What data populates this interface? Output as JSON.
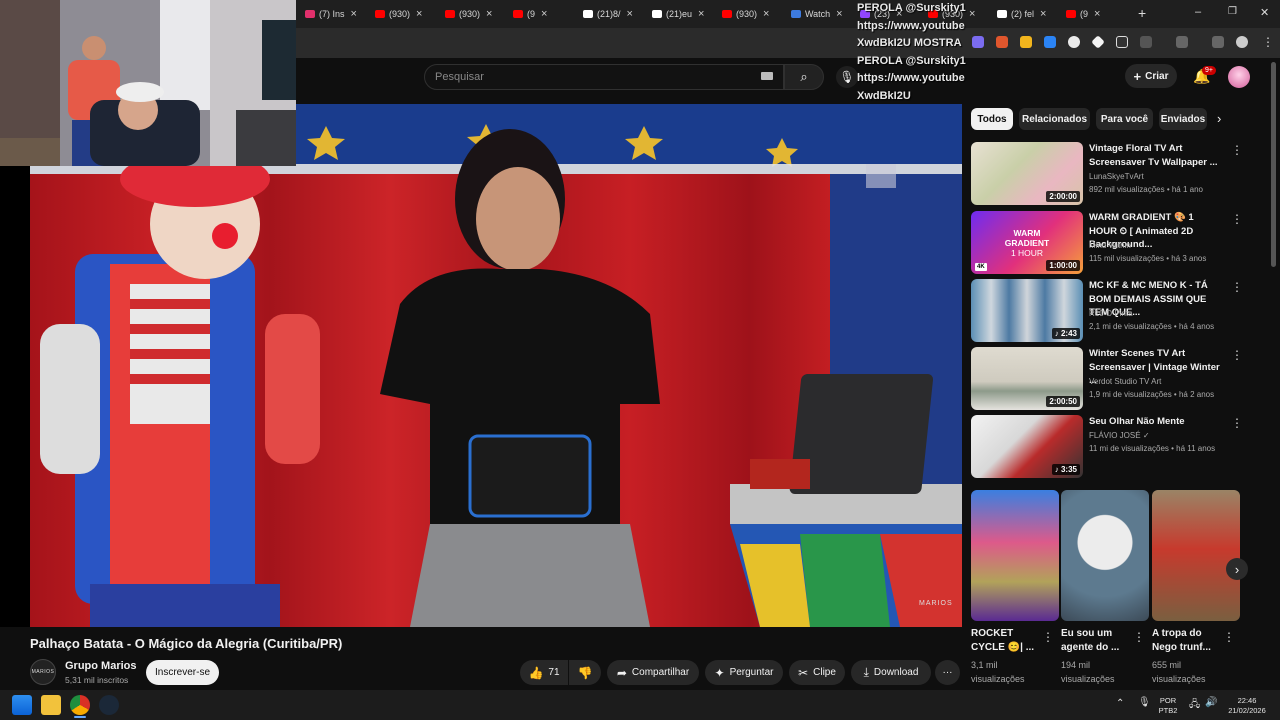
{
  "browser": {
    "tabs": [
      {
        "label": "(7) Ins",
        "icon": "instagram-icon",
        "color": "#e1306c"
      },
      {
        "label": "(930)",
        "icon": "youtube-icon",
        "color": "#ff0000"
      },
      {
        "label": "(930)",
        "icon": "youtube-icon",
        "color": "#ff0000"
      },
      {
        "label": "(9",
        "icon": "youtube-icon",
        "color": "#ff0000"
      },
      {
        "label": "(21)8/",
        "icon": "tiktok-icon",
        "color": "#ffffff"
      },
      {
        "label": "(21)eu",
        "icon": "tiktok-icon",
        "color": "#ffffff"
      },
      {
        "label": "(930)",
        "icon": "youtube-icon",
        "color": "#ff0000"
      },
      {
        "label": "Watch",
        "icon": "watch-icon",
        "color": "#3d7be0"
      },
      {
        "label": "(23)",
        "icon": "twitch-icon",
        "color": "#9146ff"
      },
      {
        "label": "(930)",
        "icon": "youtube-icon",
        "color": "#ff0000"
      },
      {
        "label": "(2) fel",
        "icon": "x-icon",
        "color": "#ffffff"
      },
      {
        "label": "(9",
        "icon": "youtube-icon",
        "color": "#ff0000"
      }
    ],
    "new_tab": "+",
    "window_controls": [
      "–",
      "❐",
      "✕"
    ]
  },
  "overlay_lines": [
    "PEROLA @Surskity1",
    "https://www.youtube",
    "XwdBkI2U MOSTRA",
    "PEROLA @Surskity1",
    "https://www.youtube",
    "XwdBkI2U"
  ],
  "header": {
    "search_placeholder": "Pesquisar",
    "create_label": "Criar",
    "notifications_badge": "9+"
  },
  "video": {
    "title": "Palhaço Batata - O Mágico da Alegria (Curitiba/PR)",
    "watermark": "MARIOS",
    "channel_name": "Grupo Marios",
    "channel_avatar_text": "MARIOS",
    "subscribers": "5,31 mil inscritos",
    "subscribe_label": "Inscrever-se",
    "likes": "71",
    "share_label": "Compartilhar",
    "ask_label": "Perguntar",
    "clip_label": "Clipe",
    "download_label": "Download",
    "more_label": "···"
  },
  "chips": [
    "Todos",
    "Relacionados",
    "Para você",
    "Enviados"
  ],
  "recommendations": [
    {
      "title": "Vintage Floral TV Art Screensaver Tv Wallpaper ...",
      "channel": "LunaSkyeTvArt",
      "meta": "892 mil visualizações • há 1 ano",
      "duration": "2:00:00"
    },
    {
      "title": "WARM GRADIENT 🎨 1 HOUR ⏲ [ Animated 2D Background...",
      "channel": "Mind Within",
      "meta": "115 mil visualizações • há 3 anos",
      "duration": "1:00:00",
      "thumb_text_1": "WARM",
      "thumb_text_2": "GRADIENT",
      "thumb_text_3": "1 HOUR",
      "badge": "4K"
    },
    {
      "title": "MC KF & MC MENO K - TÁ BOM DEMAIS ASSIM QUE TEM QUE...",
      "channel": "R10 O Pinta",
      "meta": "2,1 mi de visualizações • há 4 anos",
      "duration": "2:43"
    },
    {
      "title": "Winter Scenes TV Art Screensaver | Vintage Winter ...",
      "channel": "Verdot Studio TV Art",
      "meta": "1,9 mi de visualizações • há 2 anos",
      "duration": "2:00:50"
    },
    {
      "title": "Seu Olhar Não Mente",
      "channel": "FLÁVIO JOSÉ",
      "meta": "11 mi de visualizações • há 11 anos",
      "duration": "3:35"
    }
  ],
  "shorts": [
    {
      "title": "ROCKET CYCLE 😊| ...",
      "views": "3,1 mil visualizações"
    },
    {
      "title": "Eu sou um agente do ...",
      "views": "194 mil visualizações"
    },
    {
      "title": "A tropa do Nego trunf...",
      "views": "655 mil visualizações"
    }
  ],
  "taskbar": {
    "language_1": "POR",
    "language_2": "PTB2",
    "time": "22:46",
    "date": "21/02/2026"
  }
}
